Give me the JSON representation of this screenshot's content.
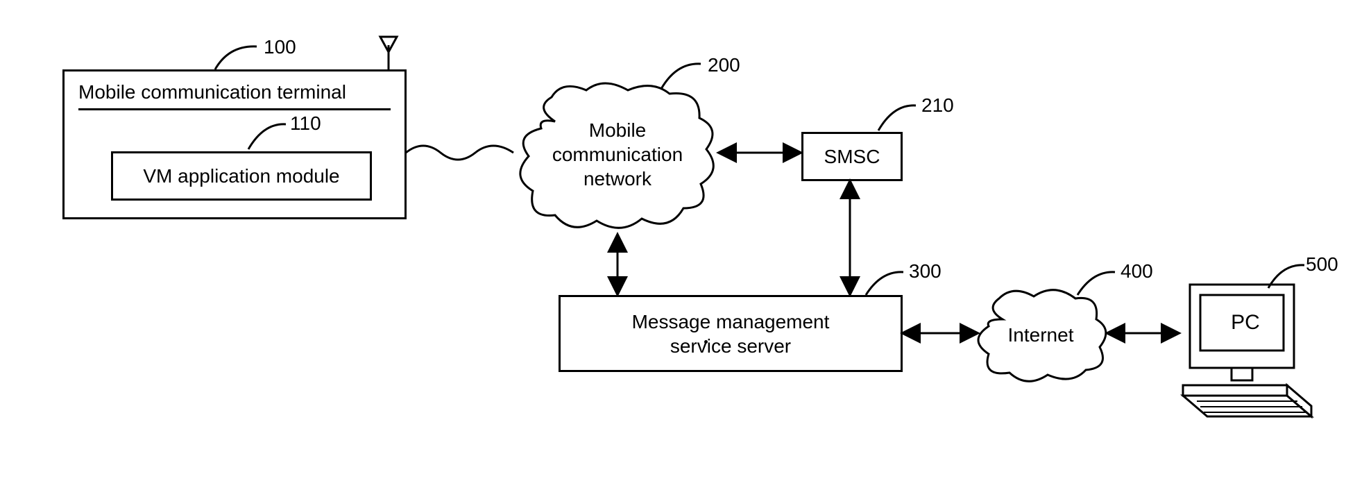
{
  "nodes": {
    "terminal": {
      "title": "Mobile communication terminal",
      "ref": "100"
    },
    "vm_module": {
      "label": "VM application module",
      "ref": "110"
    },
    "mobile_net": {
      "label": "Mobile\ncommunication\nnetwork",
      "ref": "200"
    },
    "smsc": {
      "label": "SMSC",
      "ref": "210"
    },
    "msg_server": {
      "label": "Message management\nservice server",
      "ref": "300"
    },
    "internet": {
      "label": "Internet",
      "ref": "400"
    },
    "pc": {
      "label": "PC",
      "ref": "500"
    }
  }
}
